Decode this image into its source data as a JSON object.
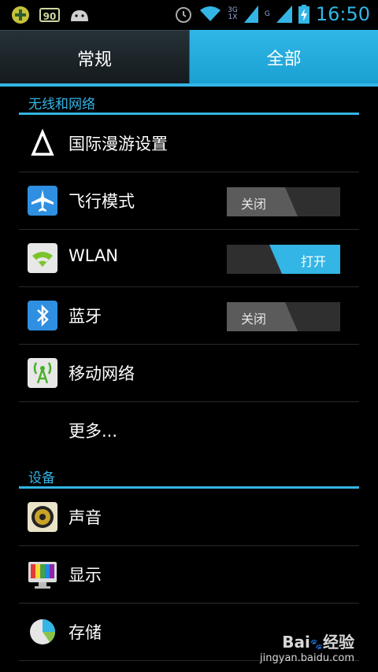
{
  "status_bar": {
    "battery_level": "90",
    "network_type_upper": "3G",
    "network_type_lower": "1X",
    "network_type_2": "G",
    "time": "16:50"
  },
  "tabs": [
    {
      "label": "常规",
      "selected": false
    },
    {
      "label": "全部",
      "selected": true
    }
  ],
  "sections": {
    "wireless": {
      "title": "无线和网络",
      "items": {
        "roaming": {
          "label": "国际漫游设置"
        },
        "airplane": {
          "label": "飞行模式",
          "toggle": "关闭",
          "state": "off"
        },
        "wlan": {
          "label": "WLAN",
          "toggle": "打开",
          "state": "on"
        },
        "bluetooth": {
          "label": "蓝牙",
          "toggle": "关闭",
          "state": "off"
        },
        "mobile": {
          "label": "移动网络"
        },
        "more": {
          "label": "更多..."
        }
      }
    },
    "device": {
      "title": "设备",
      "items": {
        "sound": {
          "label": "声音"
        },
        "display": {
          "label": "显示"
        },
        "storage": {
          "label": "存储"
        }
      }
    }
  },
  "watermark": {
    "brand": "Bai",
    "brand2": "经验",
    "url": "jingyan.baidu.com"
  },
  "colors": {
    "accent": "#33b5e5",
    "background": "#000000"
  }
}
